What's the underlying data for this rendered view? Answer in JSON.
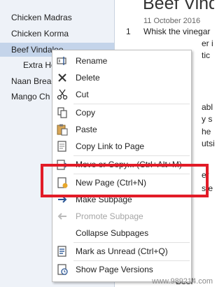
{
  "sidebar": {
    "items": [
      {
        "label": "Chicken Madras"
      },
      {
        "label": "Chicken Korma"
      },
      {
        "label": "Beef Vindaloo"
      },
      {
        "label": "Extra Ho"
      },
      {
        "label": "Naan Bread"
      },
      {
        "label": "Mango Ch"
      }
    ]
  },
  "note": {
    "title": "Beef Vinda",
    "date": "11 October 2016",
    "step_number": "1",
    "text_fragments": [
      "Whisk the vinegar",
      "er i",
      "tic",
      "abl",
      "y s",
      "he",
      "utsi",
      "er",
      "ste",
      "Beef"
    ]
  },
  "context_menu": {
    "items": [
      {
        "label": "Rename",
        "icon": "rename-icon"
      },
      {
        "label": "Delete",
        "icon": "delete-icon"
      },
      {
        "label": "Cut",
        "icon": "cut-icon"
      },
      {
        "label": "Copy",
        "icon": "copy-icon"
      },
      {
        "label": "Paste",
        "icon": "paste-icon"
      },
      {
        "label": "Copy Link to Page",
        "icon": "copy-link-icon"
      },
      {
        "label": "Move or Copy...  (Ctrl+Alt+M)",
        "icon": "move-copy-icon"
      },
      {
        "label": "New Page  (Ctrl+N)",
        "icon": "new-page-icon"
      },
      {
        "label": "Make Subpage",
        "icon": "make-subpage-icon"
      },
      {
        "label": "Promote Subpage",
        "icon": "promote-subpage-icon"
      },
      {
        "label": "Collapse Subpages",
        "icon": "collapse-subpages-icon"
      },
      {
        "label": "Mark as Unread  (Ctrl+Q)",
        "icon": "mark-unread-icon"
      },
      {
        "label": "Show Page Versions",
        "icon": "page-versions-icon"
      }
    ]
  },
  "watermark": "www.989214.com"
}
